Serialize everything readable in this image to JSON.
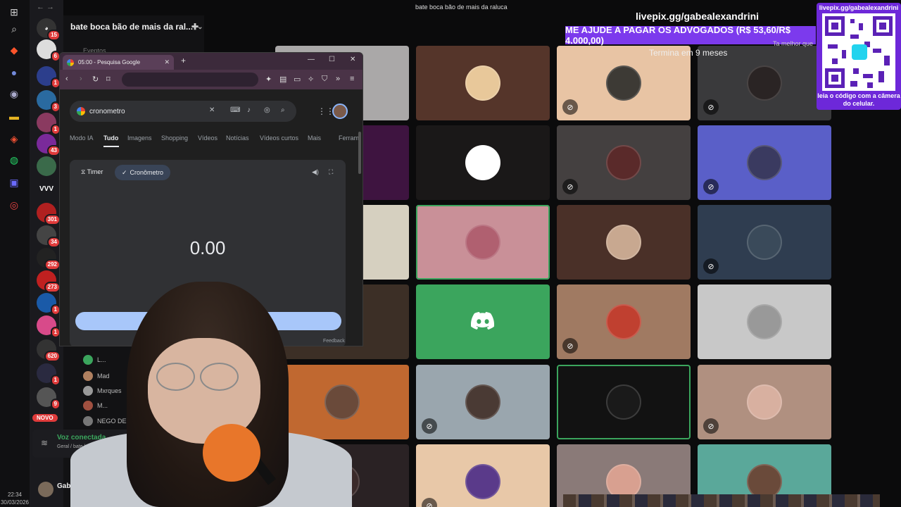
{
  "window_title": "bate boca bão de mais da raluca",
  "taskbar": {
    "time": "22:34",
    "date": "30/03/2026",
    "icons": [
      "windows-icon",
      "search-icon",
      "brave-icon",
      "discord-icon",
      "steam-icon",
      "files-icon",
      "git-icon",
      "whatsapp-icon",
      "app-icon",
      "settings-icon"
    ]
  },
  "server_rail": {
    "badges": [
      "15",
      "6",
      "1",
      "1",
      "3",
      "1",
      "43",
      "301",
      "34",
      "292",
      "273",
      "1",
      "1",
      "620",
      "1",
      "9"
    ],
    "labels": [
      "VVV"
    ],
    "new_label": "NOVO"
  },
  "channel": {
    "server_name": "bate boca bão de mais da ral...",
    "section_label": "Eventos",
    "members": [
      "L...",
      "Mad",
      "Mxrques",
      "M...",
      "NEGO DE Vi"
    ],
    "voice_status": "Voz conectada",
    "voice_channel": "Geral / bate boca b...",
    "user_name": "Gabe"
  },
  "overlay": {
    "livepix_url": "livepix.gg/gabealexandrini",
    "goal_text": "ME AJUDE A PAGAR OS ADVOGADOS (R$ 53,60/R$ 4.000,00)",
    "goal_ends": "Termina em 9 meses",
    "goal_side": "Ta melhor que",
    "qr_url": "livepix.gg/gabealexandrini",
    "qr_caption": "leia o código com a câmera do celular."
  },
  "chrome": {
    "tab_title": "05:00 - Pesquisa Google",
    "query": "cronometro",
    "filters": [
      "Modo IA",
      "Tudo",
      "Imagens",
      "Shopping",
      "Vídeos",
      "Notícias",
      "Vídeos curtos",
      "Mais",
      "Ferram"
    ],
    "active_filter": "Tudo",
    "widget": {
      "timer_label": "Timer",
      "stopwatch_label": "Cronômetro",
      "time": "0.00"
    },
    "feedback": "Feedback"
  },
  "tiles": [
    {
      "color": "#aaa8a8",
      "avatar": "#777"
    },
    {
      "color": "#55352a",
      "avatar": "#e8c89a"
    },
    {
      "color": "#e8c4a4",
      "avatar": "#3d3a35",
      "muted": true
    },
    {
      "color": "#3a3a3c",
      "avatar": "#2a2424",
      "muted": true
    },
    {
      "color": "#3e1440",
      "avatar": "#3e1440"
    },
    {
      "color": "#1a1818",
      "avatar": "#ffffff"
    },
    {
      "color": "#444040",
      "avatar": "#5a2a2a",
      "muted": true
    },
    {
      "color": "#5a5fc8",
      "avatar": "#3a3a60",
      "muted": true
    },
    {
      "color": "#d6d0c0",
      "avatar": "#d6d0c0"
    },
    {
      "color": "#c99098",
      "avatar": "#b06070",
      "speaking": true
    },
    {
      "color": "#4a3028",
      "avatar": "#c8a890"
    },
    {
      "color": "#2f3d50",
      "avatar": "#3a4a5a",
      "muted": true
    },
    {
      "color": "#3c2f26",
      "avatar": "#3c2f26"
    },
    {
      "color": "#3ba55d",
      "avatar": "discord"
    },
    {
      "color": "#a07a62",
      "avatar": "#c04030",
      "muted": true
    },
    {
      "color": "#c8c8c8",
      "avatar": "#999",
      "muted": false
    },
    {
      "color": "#c06830",
      "avatar": "#6a4a3a"
    },
    {
      "color": "#9aa6ae",
      "avatar": "#4a3a34",
      "muted": true
    },
    {
      "color": "#121212",
      "avatar": "#1a1a1a",
      "speaking": true
    },
    {
      "color": "#b09080",
      "avatar": "#d8b0a0",
      "muted": true
    },
    {
      "color": "#2a2224",
      "avatar": "#3a2a2a"
    },
    {
      "color": "#e8c8a8",
      "avatar": "#5a3a8a",
      "muted": true
    },
    {
      "color": "#8a7a78",
      "avatar": "#d8a090"
    },
    {
      "color": "#5aa89a",
      "avatar": "#6a4a3a"
    }
  ]
}
